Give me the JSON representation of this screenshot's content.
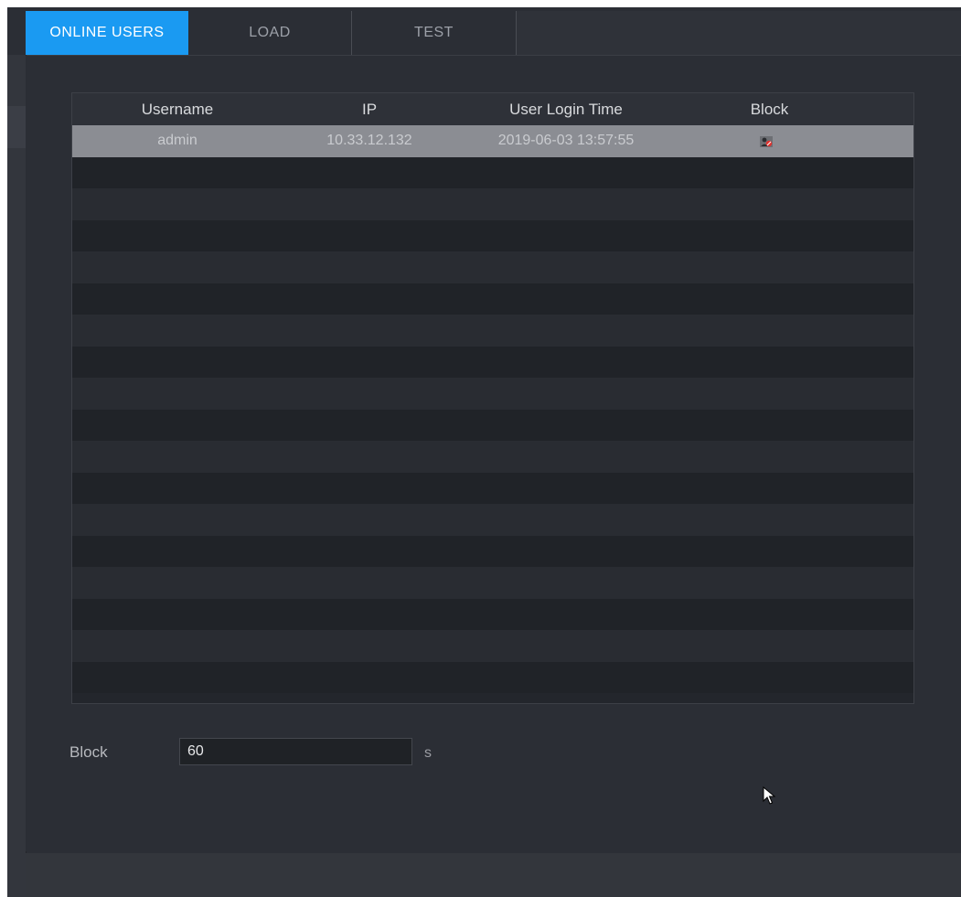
{
  "tabs": [
    {
      "label": "ONLINE USERS",
      "active": true
    },
    {
      "label": "LOAD",
      "active": false
    },
    {
      "label": "TEST",
      "active": false
    }
  ],
  "table": {
    "columns": [
      "Username",
      "IP",
      "User Login Time",
      "Block"
    ],
    "rows": [
      {
        "username": "admin",
        "ip": "10.33.12.132",
        "login_time": "2019-06-03 13:57:55",
        "block_icon": "block-user-icon"
      }
    ]
  },
  "block_setting": {
    "label": "Block",
    "value": "60",
    "unit": "s"
  },
  "colors": {
    "accent": "#1a9af2",
    "background": "#2b2e35",
    "selected_row": "#8b8d93"
  }
}
